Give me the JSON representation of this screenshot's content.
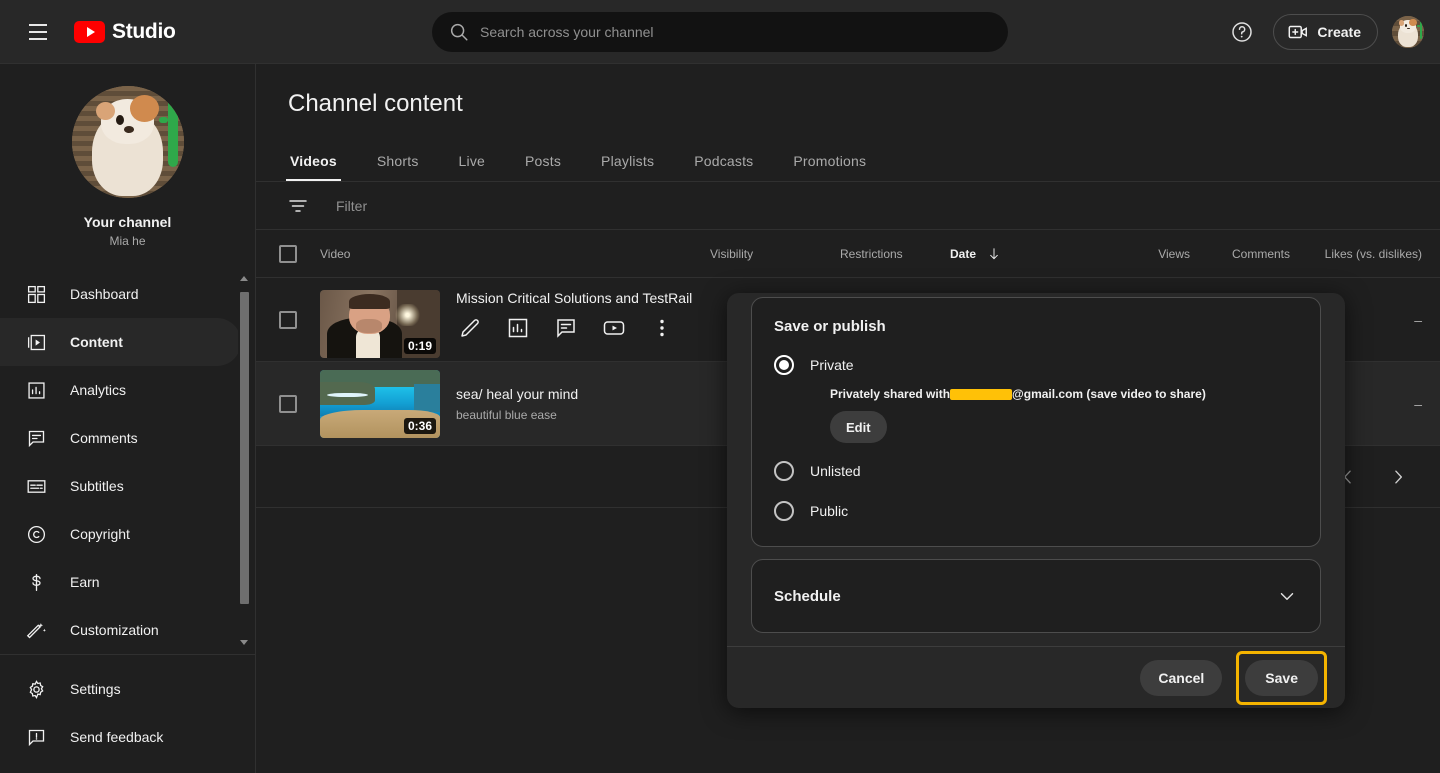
{
  "topbar": {
    "menu_label": "menu",
    "brand": "Studio",
    "search_placeholder": "Search across your channel",
    "help_label": "?",
    "create_label": "Create"
  },
  "sidebar": {
    "channel_title": "Your channel",
    "channel_handle": "Mia he",
    "items": [
      {
        "label": "Dashboard",
        "icon": "dashboard-icon",
        "active": false
      },
      {
        "label": "Content",
        "icon": "content-icon",
        "active": true
      },
      {
        "label": "Analytics",
        "icon": "analytics-icon",
        "active": false
      },
      {
        "label": "Comments",
        "icon": "comments-icon",
        "active": false
      },
      {
        "label": "Subtitles",
        "icon": "subtitles-icon",
        "active": false
      },
      {
        "label": "Copyright",
        "icon": "copyright-icon",
        "active": false
      },
      {
        "label": "Earn",
        "icon": "earn-icon",
        "active": false
      },
      {
        "label": "Customization",
        "icon": "customization-icon",
        "active": false
      }
    ],
    "bottom_items": [
      {
        "label": "Settings",
        "icon": "gear-icon"
      },
      {
        "label": "Send feedback",
        "icon": "feedback-icon"
      }
    ]
  },
  "main": {
    "page_title": "Channel content",
    "tabs": [
      {
        "label": "Videos",
        "active": true
      },
      {
        "label": "Shorts",
        "active": false
      },
      {
        "label": "Live",
        "active": false
      },
      {
        "label": "Posts",
        "active": false
      },
      {
        "label": "Playlists",
        "active": false
      },
      {
        "label": "Podcasts",
        "active": false
      },
      {
        "label": "Promotions",
        "active": false
      }
    ],
    "filter_placeholder": "Filter",
    "table": {
      "headers": {
        "video": "Video",
        "visibility": "Visibility",
        "restrictions": "Restrictions",
        "date": "Date",
        "views": "Views",
        "comments": "Comments",
        "likes": "Likes (vs. dislikes)"
      },
      "sort_column": "Date",
      "sort_direction": "descending",
      "rows": [
        {
          "title": "Mission Critical Solutions and TestRail",
          "description": "",
          "duration": "0:19",
          "likes": "–",
          "actions": [
            "edit-icon",
            "analytics-icon",
            "comments-icon",
            "youtube-icon",
            "more-options-icon"
          ]
        },
        {
          "title": "sea/ heal your mind",
          "description": "beautiful blue ease",
          "duration": "0:36",
          "likes": "–",
          "actions": []
        }
      ]
    },
    "pagination": {
      "prev_label": "‹",
      "next_label": "›"
    }
  },
  "modal": {
    "section_title": "Save or publish",
    "options": [
      {
        "label": "Private",
        "selected": true
      },
      {
        "label": "Unlisted",
        "selected": false
      },
      {
        "label": "Public",
        "selected": false
      }
    ],
    "shared_prefix": "Privately shared with",
    "shared_suffix": "@gmail.com (save video to share)",
    "edit_label": "Edit",
    "schedule_label": "Schedule",
    "cancel_label": "Cancel",
    "save_label": "Save",
    "highlight_color": "#f5b400",
    "redaction_color": "#ffc107"
  }
}
